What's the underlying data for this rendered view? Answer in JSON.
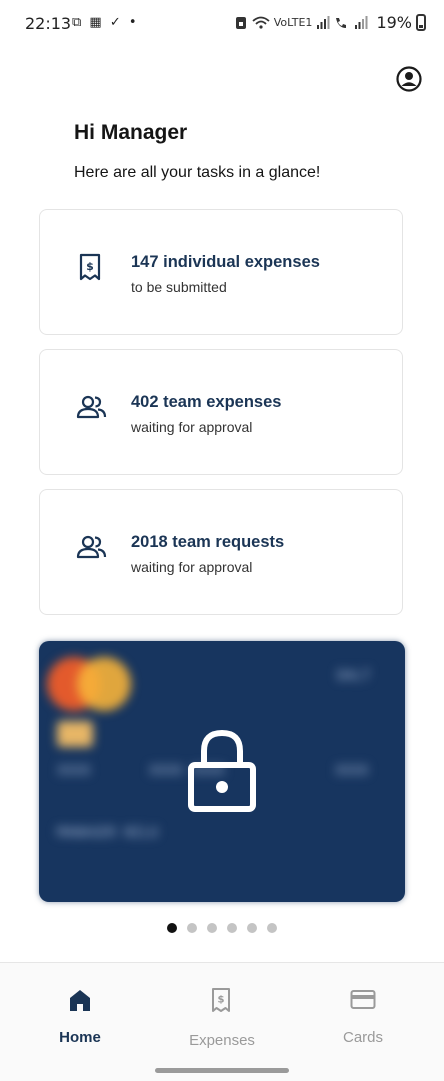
{
  "status_bar": {
    "time": "22:13",
    "left_icons": "⧉ ▦ ✓ •",
    "network_label": "VoLTE1",
    "battery": "19%"
  },
  "header": {
    "greeting": "Hi Manager",
    "subtitle": "Here are all your tasks in a glance!"
  },
  "tasks": [
    {
      "icon": "receipt-dollar-icon",
      "title": "147 individual expenses",
      "subtitle": "to be submitted"
    },
    {
      "icon": "people-icon",
      "title": "402 team expenses",
      "subtitle": "waiting for approval"
    },
    {
      "icon": "people-icon",
      "title": "2018 team requests",
      "subtitle": "waiting for approval"
    }
  ],
  "card_preview": {
    "blurred_brand_text": "DALT",
    "blurred_number_groups": [
      "XXXX",
      "XXXX XXXX",
      "XXXX"
    ],
    "blurred_holder": "MANAGER NILU",
    "lock_icon": "lock-icon",
    "colors": {
      "card": "#17355f"
    }
  },
  "carousel": {
    "count": 6,
    "active_index": 0
  },
  "bottom_nav": {
    "items": [
      {
        "label": "Home",
        "icon": "home-icon",
        "active": true
      },
      {
        "label": "Expenses",
        "icon": "receipt-dollar-icon",
        "active": false
      },
      {
        "label": "Cards",
        "icon": "credit-card-icon",
        "active": false
      }
    ],
    "colors": {
      "active": "#1b3555",
      "inactive": "#9a9a9a"
    }
  }
}
